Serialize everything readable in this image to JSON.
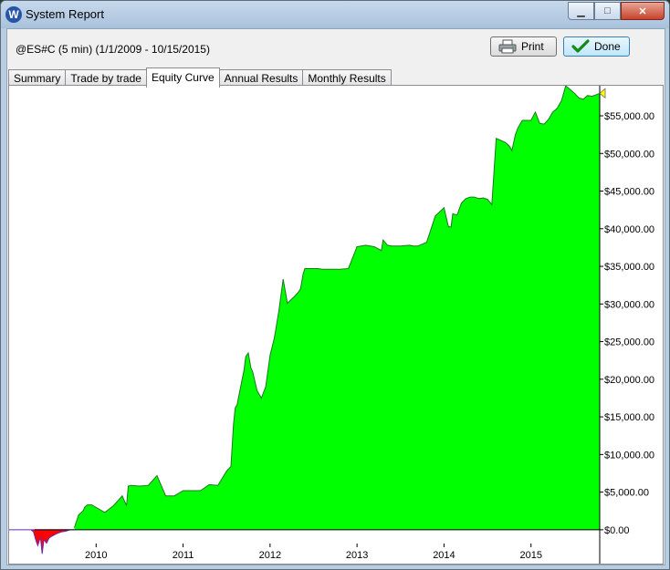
{
  "window": {
    "title": "System Report",
    "app_icon_letter": "W",
    "min_glyph": "▁",
    "max_glyph": "□",
    "close_glyph": "✕"
  },
  "report": {
    "symbol_label": "@ES#C (5 min)  (1/1/2009 - 10/15/2015)",
    "print_label": "Print",
    "done_label": "Done"
  },
  "tabs": [
    {
      "label": "Summary",
      "active": false
    },
    {
      "label": "Trade by trade",
      "active": false
    },
    {
      "label": "Equity Curve",
      "active": true
    },
    {
      "label": "Annual Results",
      "active": false
    },
    {
      "label": "Monthly Results",
      "active": false
    }
  ],
  "colors": {
    "positive_fill": "#00ff00",
    "positive_line": "#1a7a1a",
    "negative_fill": "#ff0000",
    "negative_line": "#6a2ab0",
    "marker": "#ffff00"
  },
  "chart_data": {
    "type": "area",
    "x_tick_labels": [
      "2010",
      "2011",
      "2012",
      "2013",
      "2014",
      "2015"
    ],
    "x_ticks": [
      2010.0,
      2011.0,
      2012.0,
      2013.0,
      2014.0,
      2015.0
    ],
    "y_tick_labels": [
      "$0.00",
      "$5,000.00",
      "$10,000.00",
      "$15,000.00",
      "$20,000.00",
      "$25,000.00",
      "$30,000.00",
      "$35,000.00",
      "$40,000.00",
      "$45,000.00",
      "$50,000.00",
      "$55,000.00"
    ],
    "y_ticks": [
      0,
      5000,
      10000,
      15000,
      20000,
      25000,
      30000,
      35000,
      40000,
      45000,
      50000,
      55000
    ],
    "xlim": [
      2009.0,
      2015.79
    ],
    "ylim": [
      -4500,
      59000
    ],
    "grid": false,
    "x": [
      2009.0,
      2009.25,
      2009.28,
      2009.31,
      2009.33,
      2009.36,
      2009.38,
      2009.4,
      2009.43,
      2009.46,
      2009.5,
      2009.55,
      2009.6,
      2009.65,
      2009.7,
      2009.75,
      2009.8,
      2009.85,
      2009.87,
      2009.9,
      2009.95,
      2010.1,
      2010.2,
      2010.3,
      2010.35,
      2010.37,
      2010.4,
      2010.5,
      2010.6,
      2010.7,
      2010.8,
      2010.85,
      2010.9,
      2011.0,
      2011.1,
      2011.2,
      2011.3,
      2011.4,
      2011.5,
      2011.55,
      2011.58,
      2011.6,
      2011.62,
      2011.65,
      2011.7,
      2011.72,
      2011.75,
      2011.78,
      2011.8,
      2011.85,
      2011.9,
      2011.95,
      2012.0,
      2012.05,
      2012.1,
      2012.15,
      2012.2,
      2012.28,
      2012.32,
      2012.35,
      2012.38,
      2012.4,
      2012.42,
      2012.45,
      2012.5,
      2012.55,
      2012.6,
      2012.7,
      2012.8,
      2012.9,
      2013.0,
      2013.1,
      2013.2,
      2013.28,
      2013.3,
      2013.35,
      2013.4,
      2013.5,
      2013.6,
      2013.65,
      2013.7,
      2013.8,
      2013.9,
      2014.0,
      2014.05,
      2014.08,
      2014.1,
      2014.15,
      2014.2,
      2014.25,
      2014.3,
      2014.35,
      2014.4,
      2014.45,
      2014.5,
      2014.55,
      2014.6,
      2014.7,
      2014.75,
      2014.78,
      2014.82,
      2014.85,
      2014.9,
      2014.95,
      2015.0,
      2015.05,
      2015.1,
      2015.15,
      2015.2,
      2015.25,
      2015.3,
      2015.35,
      2015.4,
      2015.45,
      2015.5,
      2015.55,
      2015.6,
      2015.65,
      2015.7,
      2015.75,
      2015.79
    ],
    "values": [
      0,
      0,
      -300,
      -1500,
      -2100,
      -1000,
      -3200,
      -1300,
      -1800,
      -1100,
      -800,
      -500,
      -300,
      -200,
      0,
      300,
      2000,
      2500,
      3000,
      3300,
      3300,
      2300,
      3200,
      4500,
      3200,
      5800,
      5900,
      5800,
      5900,
      7200,
      4500,
      4500,
      4500,
      5200,
      5200,
      5200,
      6000,
      5900,
      7800,
      8400,
      14000,
      16200,
      16600,
      18300,
      21200,
      23000,
      23500,
      21500,
      21000,
      18500,
      17500,
      19000,
      23200,
      25500,
      29000,
      33300,
      30100,
      31000,
      31500,
      32000,
      34000,
      34700,
      34700,
      34700,
      34700,
      34700,
      34600,
      34600,
      34600,
      34700,
      37600,
      37800,
      37600,
      37100,
      38500,
      37800,
      37700,
      37700,
      37800,
      37700,
      37700,
      38200,
      41700,
      42800,
      40300,
      40200,
      42000,
      41800,
      43400,
      44000,
      44200,
      44200,
      44000,
      44100,
      43900,
      43200,
      52000,
      51500,
      51000,
      50400,
      52500,
      53400,
      54400,
      54400,
      54400,
      55500,
      54000,
      53900,
      54500,
      55500,
      56000,
      57000,
      59000,
      58500,
      58000,
      57400,
      57200,
      57700,
      57600,
      57800,
      58000
    ]
  }
}
